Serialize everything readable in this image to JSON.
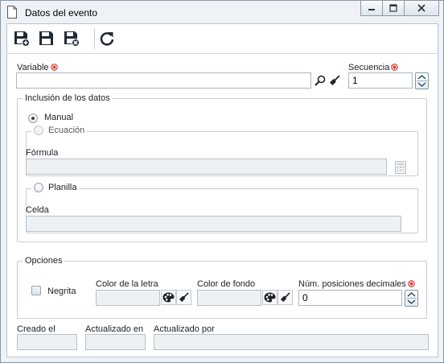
{
  "window": {
    "title": "Datos del evento"
  },
  "toolbar": {
    "save_new_icon": "save-and-new-icon",
    "save_icon": "save-icon",
    "save_close_icon": "save-and-close-icon",
    "refresh_icon": "refresh-icon"
  },
  "form": {
    "variable_label": "Variable",
    "variable_value": "",
    "secuencia_label": "Secuencia",
    "secuencia_value": "1",
    "inclusion": {
      "legend": "Inclusión de los datos",
      "manual_label": "Manual",
      "manual_selected": true,
      "ecuacion_label": "Ecuación",
      "formula_label": "Fórmula",
      "formula_value": "",
      "planilla_label": "Planilla",
      "celda_label": "Celda",
      "celda_value": ""
    },
    "opciones": {
      "legend": "Opciones",
      "negrita_label": "Negrita",
      "negrita_checked": false,
      "color_letra_label": "Color de la letra",
      "color_fondo_label": "Color de fondo",
      "decimales_label": "Núm. posiciones decimales",
      "decimales_value": "0"
    },
    "audit": {
      "creado_label": "Creado el",
      "creado_value": "",
      "actualizado_en_label": "Actualizado en",
      "actualizado_en_value": "",
      "actualizado_por_label": "Actualizado por",
      "actualizado_por_value": ""
    }
  },
  "colors": {
    "required_mark": "#d9302a",
    "save_icon": "#1f2a36",
    "accent_border": "#7f93a8"
  }
}
